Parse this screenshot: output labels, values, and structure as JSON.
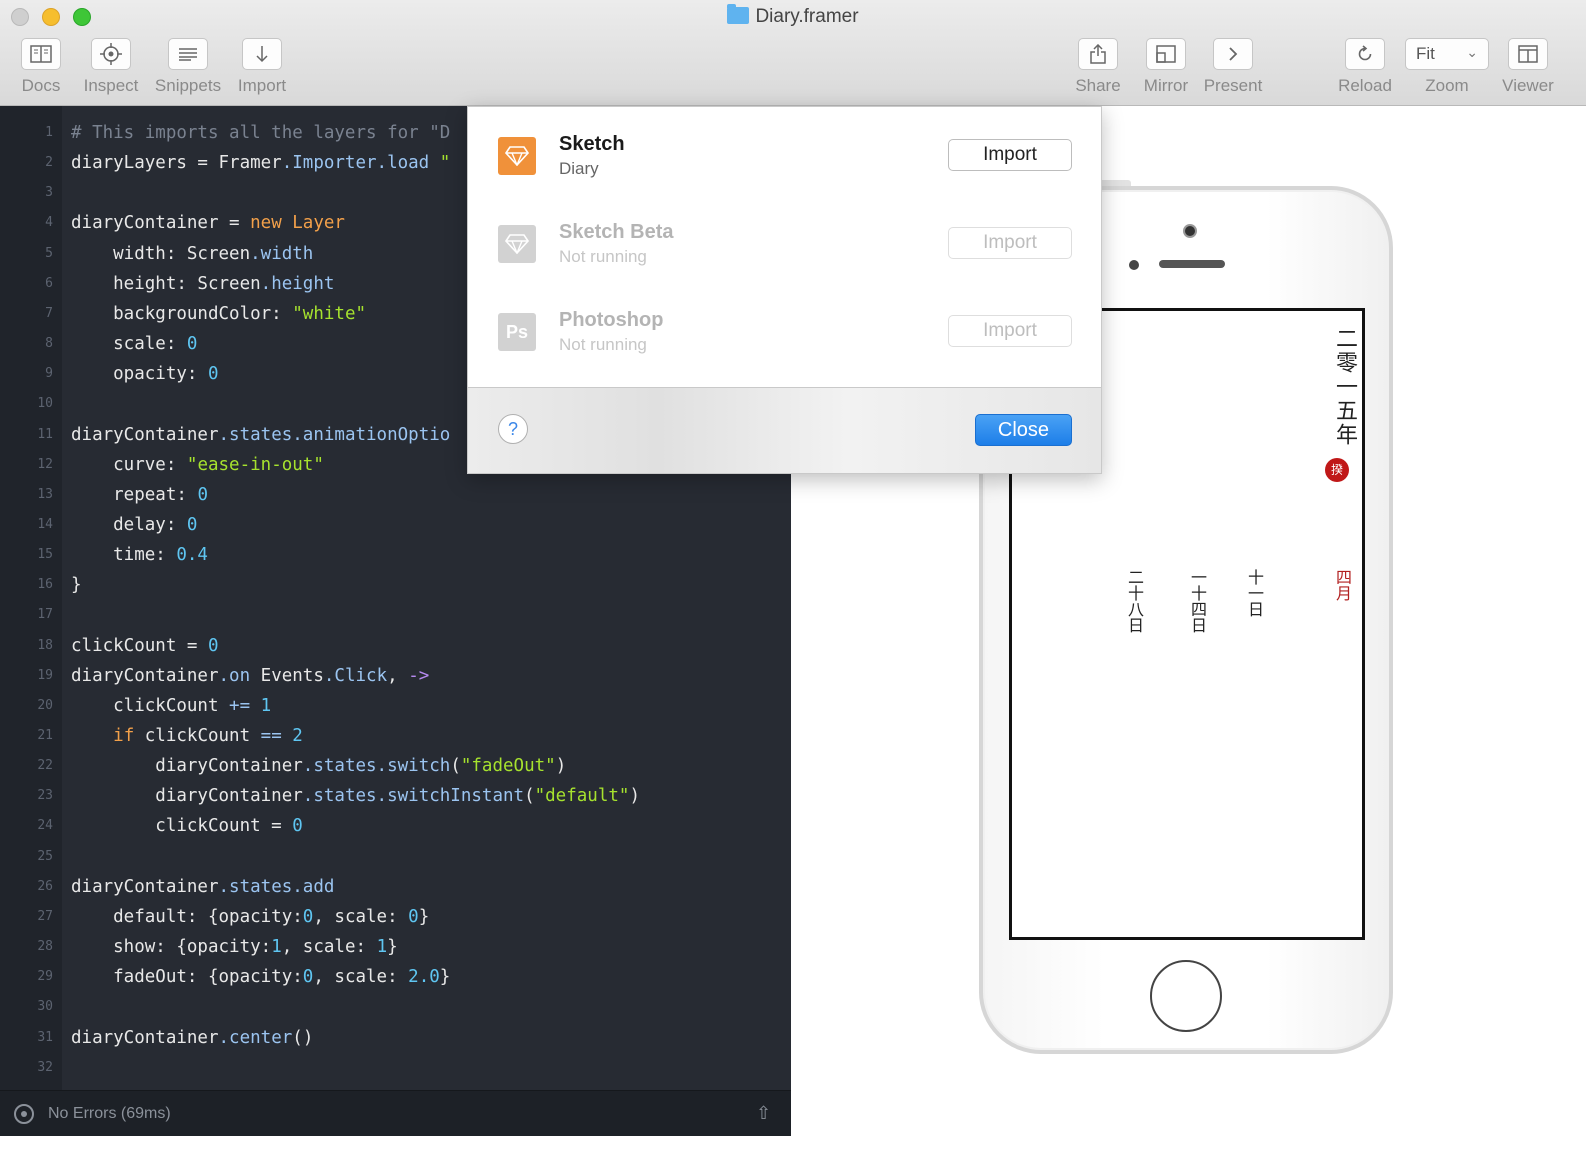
{
  "window": {
    "title": "Diary.framer"
  },
  "toolbar": {
    "left": [
      {
        "label": "Docs",
        "icon": "book-icon"
      },
      {
        "label": "Inspect",
        "icon": "crosshair-icon"
      },
      {
        "label": "Snippets",
        "icon": "lines-icon"
      },
      {
        "label": "Import",
        "icon": "arrow-down-icon"
      }
    ],
    "right": [
      {
        "label": "Share",
        "icon": "share-icon"
      },
      {
        "label": "Mirror",
        "icon": "mirror-icon"
      },
      {
        "label": "Present",
        "icon": "chevron-right-icon"
      },
      {
        "label": "Reload",
        "icon": "reload-icon"
      },
      {
        "label": "Zoom",
        "value": "Fit"
      },
      {
        "label": "Viewer",
        "icon": "viewer-layout-icon"
      }
    ]
  },
  "editor": {
    "lines": [
      {
        "n": "1",
        "tokens": [
          [
            "c-comment",
            "# This imports all the layers for \"D"
          ]
        ]
      },
      {
        "n": "2",
        "tokens": [
          [
            "",
            "diaryLayers = Framer"
          ],
          [
            "c-prop",
            ".Importer.load "
          ],
          [
            "c-str",
            "\""
          ]
        ]
      },
      {
        "n": "3",
        "tokens": []
      },
      {
        "n": "4",
        "tokens": [
          [
            "",
            "diaryContainer = "
          ],
          [
            "c-kw",
            "new Layer"
          ]
        ]
      },
      {
        "n": "5",
        "tokens": [
          [
            "",
            "    width: Screen"
          ],
          [
            "c-prop",
            ".width"
          ]
        ]
      },
      {
        "n": "6",
        "tokens": [
          [
            "",
            "    height: Screen"
          ],
          [
            "c-prop",
            ".height"
          ]
        ]
      },
      {
        "n": "7",
        "tokens": [
          [
            "",
            "    backgroundColor: "
          ],
          [
            "c-str",
            "\"white\""
          ]
        ]
      },
      {
        "n": "8",
        "tokens": [
          [
            "",
            "    scale: "
          ],
          [
            "c-num",
            "0"
          ]
        ]
      },
      {
        "n": "9",
        "tokens": [
          [
            "",
            "    opacity: "
          ],
          [
            "c-num",
            "0"
          ]
        ]
      },
      {
        "n": "10",
        "tokens": []
      },
      {
        "n": "11",
        "tokens": [
          [
            "",
            "diaryContainer"
          ],
          [
            "c-prop",
            ".states.animationOptio"
          ]
        ]
      },
      {
        "n": "12",
        "tokens": [
          [
            "",
            "    curve: "
          ],
          [
            "c-str",
            "\"ease-in-out\""
          ]
        ]
      },
      {
        "n": "13",
        "tokens": [
          [
            "",
            "    repeat: "
          ],
          [
            "c-num",
            "0"
          ]
        ]
      },
      {
        "n": "14",
        "tokens": [
          [
            "",
            "    delay: "
          ],
          [
            "c-num",
            "0"
          ]
        ]
      },
      {
        "n": "15",
        "tokens": [
          [
            "",
            "    time: "
          ],
          [
            "c-num",
            "0.4"
          ]
        ]
      },
      {
        "n": "16",
        "tokens": [
          [
            "",
            "}"
          ]
        ]
      },
      {
        "n": "17",
        "tokens": []
      },
      {
        "n": "18",
        "tokens": [
          [
            "",
            "clickCount = "
          ],
          [
            "c-num",
            "0"
          ]
        ]
      },
      {
        "n": "19",
        "tokens": [
          [
            "",
            "diaryContainer"
          ],
          [
            "c-prop",
            ".on"
          ],
          [
            "",
            " Events"
          ],
          [
            "c-prop",
            ".Click"
          ],
          [
            "",
            ", "
          ],
          [
            "c-arrow",
            "->"
          ]
        ]
      },
      {
        "n": "20",
        "tokens": [
          [
            "",
            "    clickCount "
          ],
          [
            "c-prop",
            "+="
          ],
          [
            "",
            " "
          ],
          [
            "c-num",
            "1"
          ]
        ]
      },
      {
        "n": "21",
        "tokens": [
          [
            "",
            "    "
          ],
          [
            "c-kw",
            "if"
          ],
          [
            "",
            " clickCount "
          ],
          [
            "c-prop",
            "=="
          ],
          [
            "",
            " "
          ],
          [
            "c-num",
            "2"
          ]
        ]
      },
      {
        "n": "22",
        "tokens": [
          [
            "",
            "        diaryContainer"
          ],
          [
            "c-prop",
            ".states.switch"
          ],
          [
            "",
            "("
          ],
          [
            "c-str",
            "\"fadeOut\""
          ],
          [
            "",
            ")"
          ]
        ]
      },
      {
        "n": "23",
        "tokens": [
          [
            "",
            "        diaryContainer"
          ],
          [
            "c-prop",
            ".states.switchInstant"
          ],
          [
            "",
            "("
          ],
          [
            "c-str",
            "\"default\""
          ],
          [
            "",
            ")"
          ]
        ]
      },
      {
        "n": "24",
        "tokens": [
          [
            "",
            "        clickCount = "
          ],
          [
            "c-num",
            "0"
          ]
        ]
      },
      {
        "n": "25",
        "tokens": []
      },
      {
        "n": "26",
        "tokens": [
          [
            "",
            "diaryContainer"
          ],
          [
            "c-prop",
            ".states.add"
          ]
        ]
      },
      {
        "n": "27",
        "tokens": [
          [
            "",
            "    default: {opacity:"
          ],
          [
            "c-num",
            "0"
          ],
          [
            "",
            ", scale: "
          ],
          [
            "c-num",
            "0"
          ],
          [
            "",
            "}"
          ]
        ]
      },
      {
        "n": "28",
        "tokens": [
          [
            "",
            "    show: {opacity:"
          ],
          [
            "c-num",
            "1"
          ],
          [
            "",
            ", scale: "
          ],
          [
            "c-num",
            "1"
          ],
          [
            "",
            "}"
          ]
        ]
      },
      {
        "n": "29",
        "tokens": [
          [
            "",
            "    fadeOut: {opacity:"
          ],
          [
            "c-num",
            "0"
          ],
          [
            "",
            ", scale: "
          ],
          [
            "c-num",
            "2.0"
          ],
          [
            "",
            "}"
          ]
        ]
      },
      {
        "n": "30",
        "tokens": []
      },
      {
        "n": "31",
        "tokens": [
          [
            "",
            "diaryContainer"
          ],
          [
            "c-prop",
            ".center"
          ],
          [
            "",
            "()"
          ]
        ]
      },
      {
        "n": "32",
        "tokens": []
      }
    ]
  },
  "status": {
    "text": "No Errors (69ms)"
  },
  "import_dialog": {
    "apps": [
      {
        "name": "Sketch",
        "status": "Diary",
        "button": "Import",
        "enabled": true,
        "icon_color": "#f0913a",
        "icon": "sketch-diamond-icon"
      },
      {
        "name": "Sketch Beta",
        "status": "Not running",
        "button": "Import",
        "enabled": false,
        "icon_color": "#d2d2d2",
        "icon": "sketch-diamond-icon"
      },
      {
        "name": "Photoshop",
        "status": "Not running",
        "button": "Import",
        "enabled": false,
        "icon_color": "#d2d2d2",
        "icon_text": "Ps"
      }
    ],
    "help_label": "?",
    "close_label": "Close"
  },
  "preview": {
    "year": "二零一五年",
    "seal": "揆",
    "month": "四月",
    "days": [
      "十一日",
      "一十四日",
      "二十八日"
    ]
  },
  "colors": {
    "editor_bg": "#272b33",
    "primary_button": "#1d7ee8",
    "sketch_orange": "#f0913a",
    "seal_red": "#c01818"
  }
}
